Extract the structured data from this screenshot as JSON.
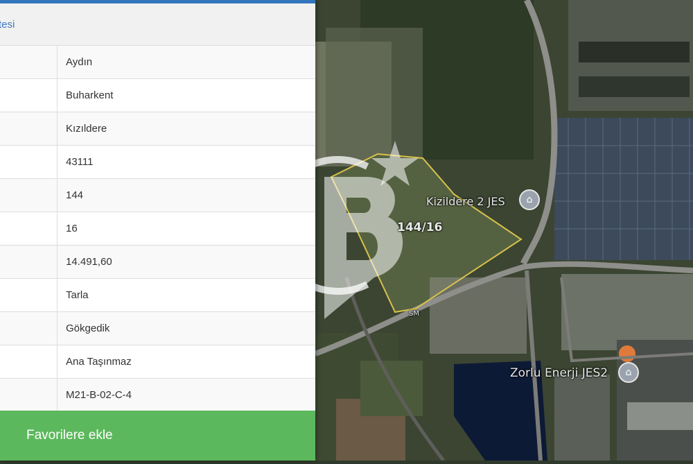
{
  "panel": {
    "header_title": "tesi",
    "rows": [
      {
        "value": "Aydın"
      },
      {
        "value": "Buharkent"
      },
      {
        "value": "Kızıldere"
      },
      {
        "value": "43111"
      },
      {
        "value": "144"
      },
      {
        "value": "16"
      },
      {
        "value": "14.491,60"
      },
      {
        "value": "Tarla"
      },
      {
        "value": "Gökgedik"
      },
      {
        "value": "Ana Taşınmaz"
      },
      {
        "value": "M21-B-02-C-4"
      }
    ],
    "favorite_button": "Favorilere ekle"
  },
  "map": {
    "parcel_label": "144/16",
    "poi_1": "Kizildere 2 JES",
    "poi_2": "Zorlu Enerji JES2",
    "small_label": "SM",
    "watermark_icon": "cb-logo-watermark",
    "poi_icon": "landmark-icon"
  },
  "colors": {
    "accent": "#3376bd",
    "favorite_button": "#5cb85c",
    "parcel_outline": "#d8c24a"
  }
}
